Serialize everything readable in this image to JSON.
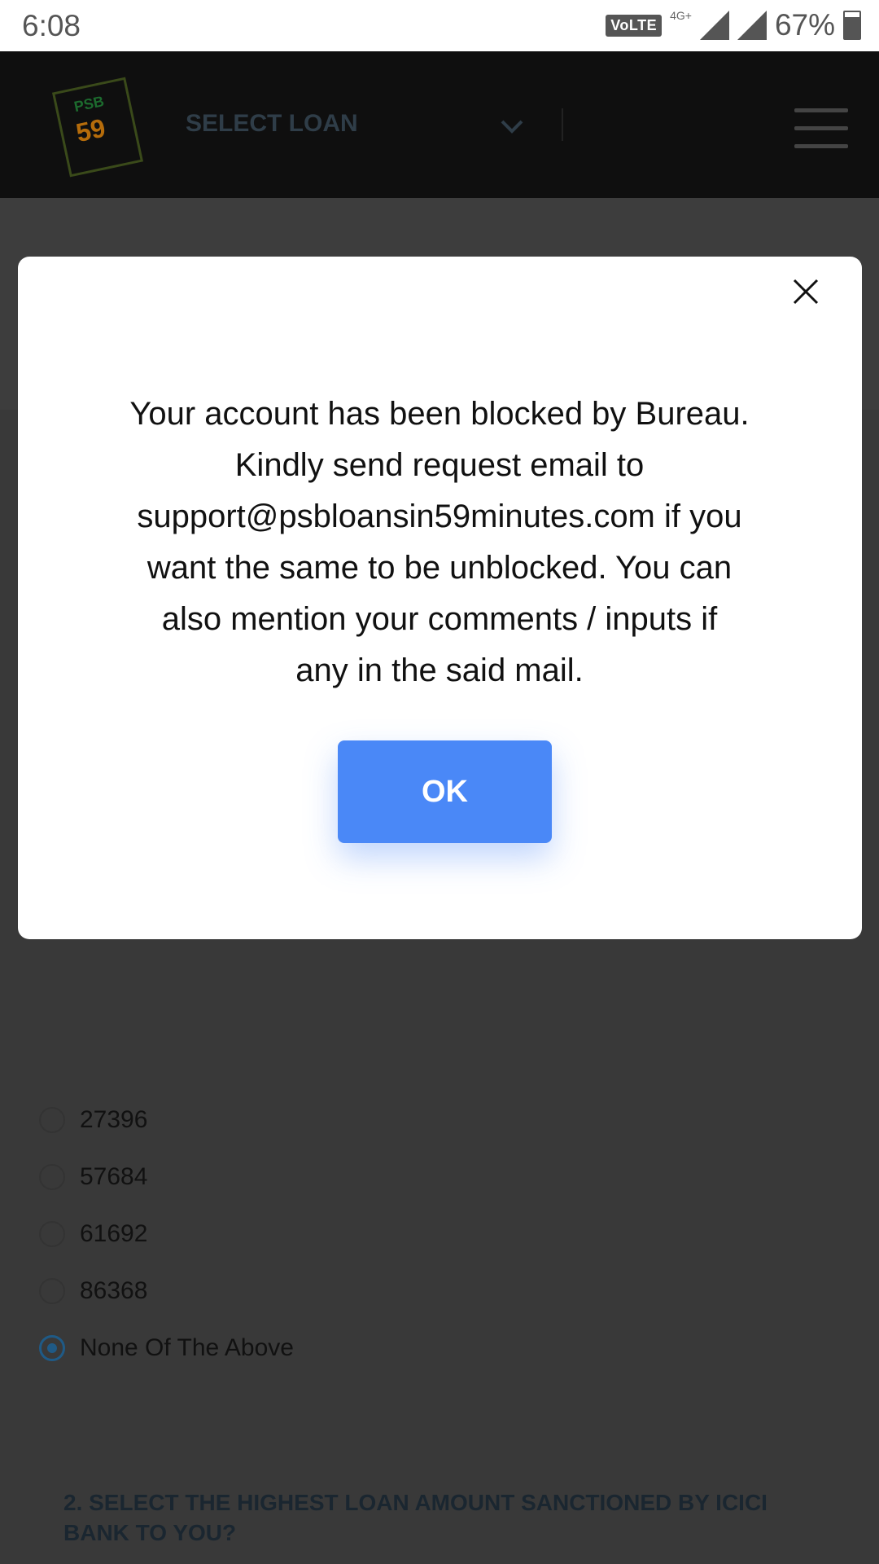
{
  "status_bar": {
    "time": "6:08",
    "volte": "VoLTE",
    "network": "4G+",
    "battery": "67%"
  },
  "header": {
    "logo_psb": "PSB",
    "logo_num": "59",
    "select_label": "SELECT LOAN"
  },
  "modal": {
    "message_lines": [
      "Your account has been blocked by Bureau.",
      "Kindly send request email to",
      "support@psbloansin59minutes.com if you",
      "want the same to be unblocked. You can",
      "also mention your comments / inputs if",
      "any in the said mail."
    ],
    "ok_label": "OK"
  },
  "options": [
    {
      "label": "27396",
      "checked": false
    },
    {
      "label": "57684",
      "checked": false
    },
    {
      "label": "61692",
      "checked": false
    },
    {
      "label": "86368",
      "checked": false
    },
    {
      "label": "None Of The Above",
      "checked": true
    }
  ],
  "question2": "2. SELECT THE HIGHEST LOAN AMOUNT SANCTIONED BY ICICI BANK TO YOU?",
  "colors": {
    "ok_button": "#4a88f7",
    "radio_selected": "#1f5a86"
  }
}
